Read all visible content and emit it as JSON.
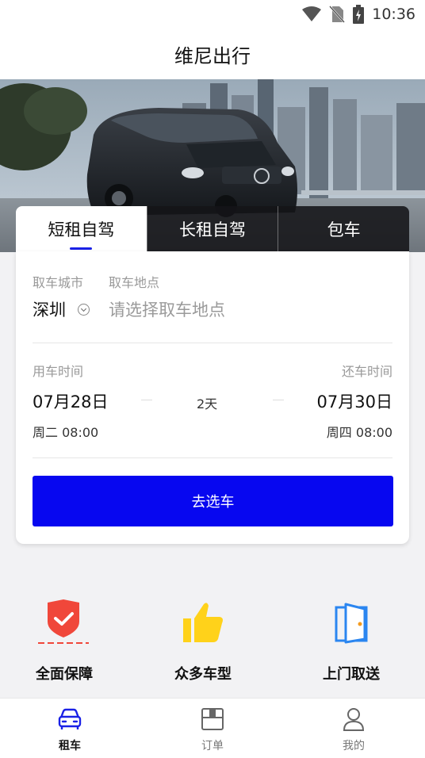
{
  "status": {
    "time": "10:36"
  },
  "header": {
    "title": "维尼出行"
  },
  "colors": {
    "accent": "#0707f0",
    "tab_indicator": "#1a21e6",
    "shield": "#f0473a",
    "thumb": "#ffd21a",
    "door": "#2b86f0"
  },
  "tabs": [
    {
      "label": "短租自驾",
      "active": true
    },
    {
      "label": "长租自驾",
      "active": false
    },
    {
      "label": "包车",
      "active": false
    }
  ],
  "booking": {
    "city_label": "取车城市",
    "city_value": "深圳",
    "location_label": "取车地点",
    "location_placeholder": "请选择取车地点",
    "pickup_label": "用车时间",
    "pickup_date": "07月28日",
    "pickup_weekday_time": "周二 08:00",
    "duration": "2天",
    "return_label": "还车时间",
    "return_date": "07月30日",
    "return_weekday_time": "周四 08:00",
    "submit_label": "去选车"
  },
  "features": [
    {
      "icon": "shield-check-icon",
      "title": "全面保障"
    },
    {
      "icon": "thumbs-up-icon",
      "title": "众多车型"
    },
    {
      "icon": "door-icon",
      "title": "上门取送"
    }
  ],
  "bottom_nav": [
    {
      "icon": "car-icon",
      "label": "租车",
      "active": true
    },
    {
      "icon": "orders-icon",
      "label": "订单",
      "active": false
    },
    {
      "icon": "profile-icon",
      "label": "我的",
      "active": false
    }
  ]
}
